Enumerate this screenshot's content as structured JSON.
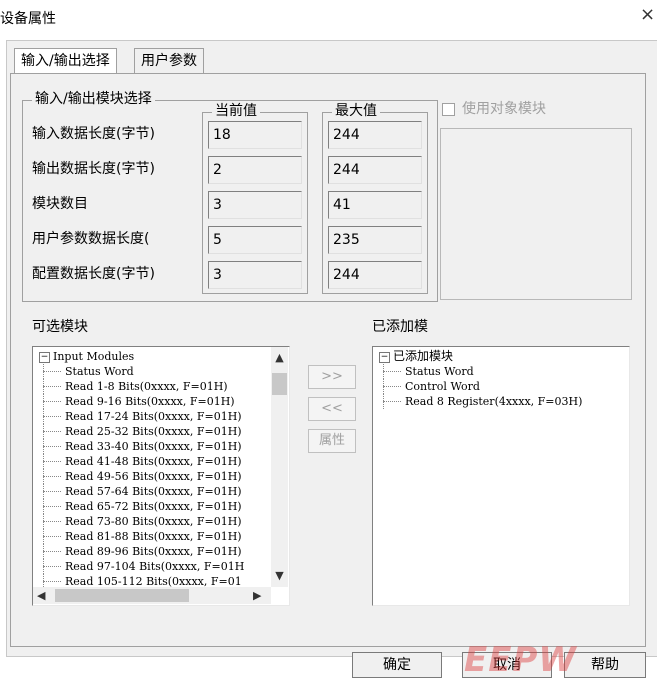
{
  "window": {
    "title": "设备属性",
    "close_glyph": "×"
  },
  "tabs": [
    {
      "label": "输入/输出选择"
    },
    {
      "label": "用户参数"
    }
  ],
  "io_group": {
    "legend": "输入/输出模块选择",
    "current_header": "当前值",
    "max_header": "最大值",
    "rows": [
      {
        "label": "输入数据长度(字节)",
        "current": "18",
        "max": "244"
      },
      {
        "label": "输出数据长度(字节)",
        "current": "2",
        "max": "244"
      },
      {
        "label": "模块数目",
        "current": "3",
        "max": "41"
      },
      {
        "label": "用户参数数据长度(",
        "current": "5",
        "max": "235"
      },
      {
        "label": "配置数据长度(字节)",
        "current": "3",
        "max": "244"
      }
    ],
    "use_object_module": "使用对象模块"
  },
  "available": {
    "label": "可选模块",
    "root": "Input Modules",
    "items": [
      "Status Word",
      "Read 1-8 Bits(0xxxx, F=01H)",
      "Read 9-16 Bits(0xxxx, F=01H)",
      "Read 17-24 Bits(0xxxx, F=01H)",
      "Read 25-32 Bits(0xxxx, F=01H)",
      "Read 33-40 Bits(0xxxx, F=01H)",
      "Read 41-48 Bits(0xxxx, F=01H)",
      "Read 49-56 Bits(0xxxx, F=01H)",
      "Read 57-64 Bits(0xxxx, F=01H)",
      "Read 65-72 Bits(0xxxx, F=01H)",
      "Read 73-80 Bits(0xxxx, F=01H)",
      "Read 81-88 Bits(0xxxx, F=01H)",
      "Read 89-96 Bits(0xxxx, F=01H)",
      "Read 97-104 Bits(0xxxx, F=01H",
      "Read 105-112 Bits(0xxxx, F=01"
    ]
  },
  "added": {
    "label": "已添加模",
    "root": "已添加模块",
    "items": [
      "Status Word",
      "Control Word",
      "Read 8 Register(4xxxx, F=03H)"
    ]
  },
  "mid_buttons": {
    "add": ">>",
    "remove": "<<",
    "props": "属性"
  },
  "footer": {
    "ok": "确定",
    "cancel": "取消",
    "help": "帮助"
  },
  "watermark": "EEPW"
}
